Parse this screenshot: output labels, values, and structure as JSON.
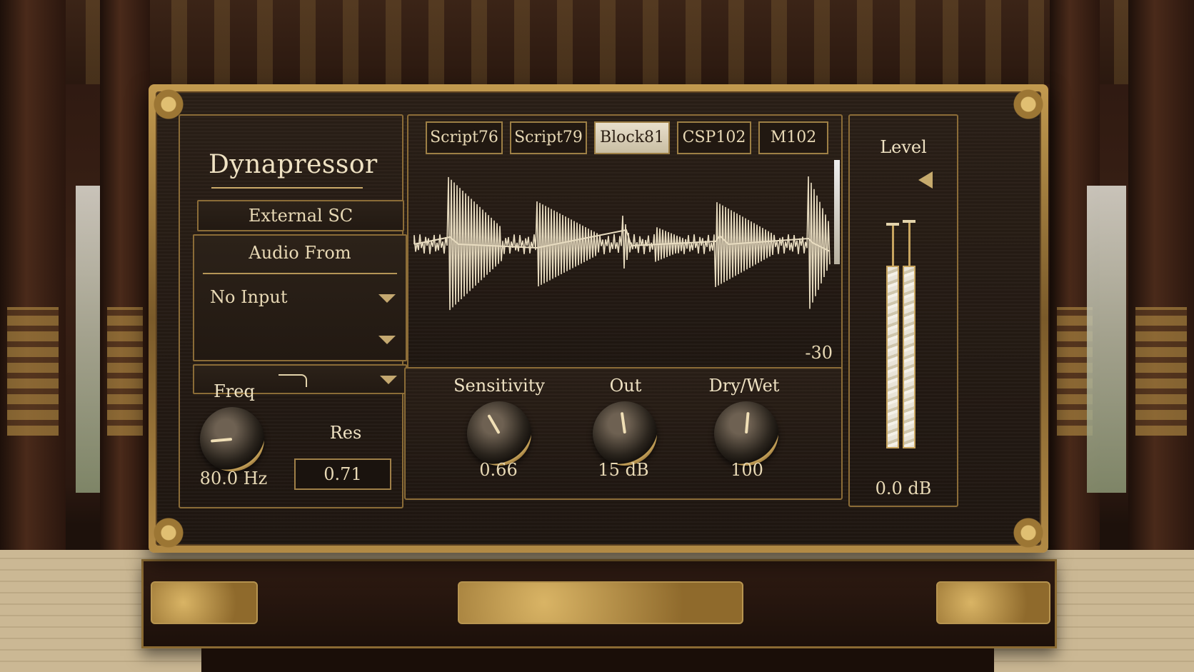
{
  "plugin": {
    "title": "Dynapressor"
  },
  "sidechain": {
    "external_label": "External SC",
    "audio_from_label": "Audio From",
    "input_value": "No Input"
  },
  "filter": {
    "freq_label": "Freq",
    "freq_value": "80.0 Hz",
    "res_label": "Res",
    "res_value": "0.71"
  },
  "tabs": [
    {
      "label": "Script76",
      "active": false
    },
    {
      "label": "Script79",
      "active": false
    },
    {
      "label": "Block81",
      "active": true
    },
    {
      "label": "CSP102",
      "active": false
    },
    {
      "label": "M102",
      "active": false
    }
  ],
  "display": {
    "scale_label": "-30"
  },
  "controls": {
    "sensitivity_label": "Sensitivity",
    "sensitivity_value": "0.66",
    "out_label": "Out",
    "out_value": "15 dB",
    "drywet_label": "Dry/Wet",
    "drywet_value": "100"
  },
  "meter": {
    "title": "Level",
    "value": "0.0 dB",
    "left_level": 1.0,
    "right_level": 1.0
  },
  "colors": {
    "gold": "#c9a968",
    "wood": "#1f1711",
    "ivory": "#e8d9b5"
  }
}
